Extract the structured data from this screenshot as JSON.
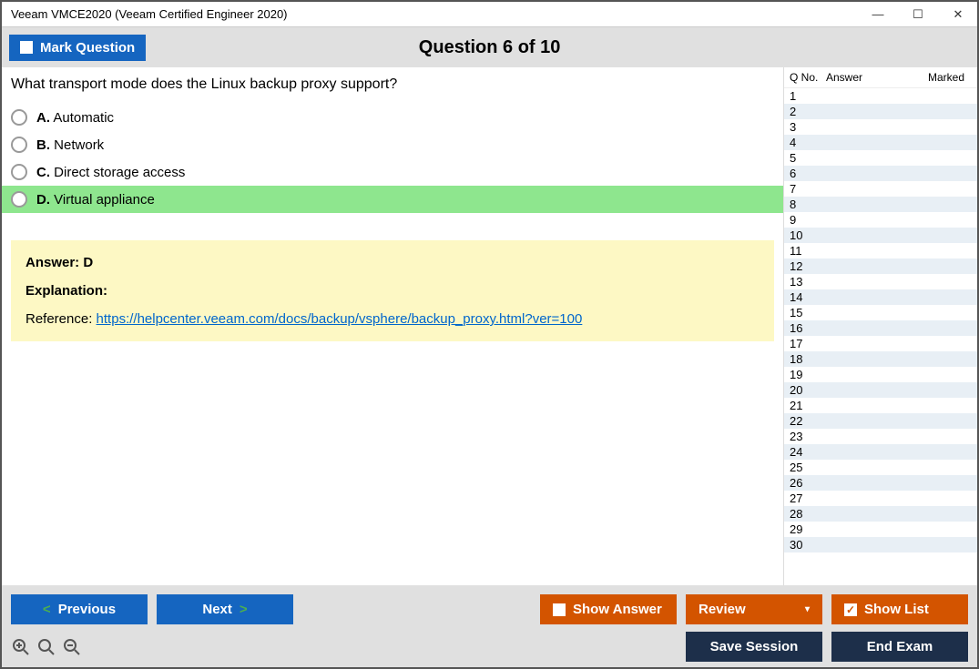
{
  "window": {
    "title": "Veeam VMCE2020 (Veeam Certified Engineer 2020)"
  },
  "header": {
    "mark_label": "Mark Question",
    "question_header": "Question 6 of 10"
  },
  "question": {
    "text": "What transport mode does the Linux backup proxy support?",
    "options": [
      {
        "letter": "A.",
        "text": "Automatic",
        "correct": false
      },
      {
        "letter": "B.",
        "text": "Network",
        "correct": false
      },
      {
        "letter": "C.",
        "text": "Direct storage access",
        "correct": false
      },
      {
        "letter": "D.",
        "text": "Virtual appliance",
        "correct": true
      }
    ]
  },
  "explanation": {
    "answer_label": "Answer: D",
    "explanation_label": "Explanation:",
    "reference_prefix": "Reference: ",
    "reference_link": "https://helpcenter.veeam.com/docs/backup/vsphere/backup_proxy.html?ver=100"
  },
  "side": {
    "headers": {
      "qno": "Q No.",
      "answer": "Answer",
      "marked": "Marked"
    },
    "rows": [
      1,
      2,
      3,
      4,
      5,
      6,
      7,
      8,
      9,
      10,
      11,
      12,
      13,
      14,
      15,
      16,
      17,
      18,
      19,
      20,
      21,
      22,
      23,
      24,
      25,
      26,
      27,
      28,
      29,
      30
    ]
  },
  "footer": {
    "previous": "Previous",
    "next": "Next",
    "show_answer": "Show Answer",
    "review": "Review",
    "show_list": "Show List",
    "save_session": "Save Session",
    "end_exam": "End Exam"
  }
}
